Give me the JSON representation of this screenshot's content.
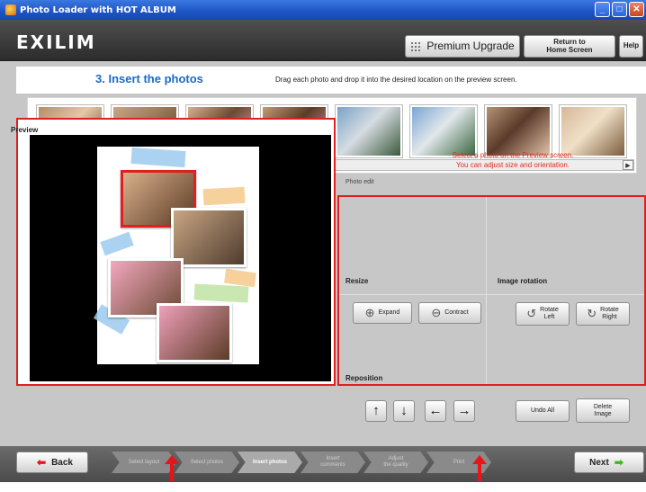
{
  "window": {
    "title": "Photo Loader with HOT ALBUM",
    "controls": [
      "_",
      "□",
      "✕"
    ]
  },
  "header": {
    "logo": "EXILIM",
    "premium_label": "Premium Upgrade",
    "home_label": "Return to\nHome Screen",
    "help_label": "Help"
  },
  "step": {
    "title": "3. Insert the photos",
    "instructions": "Drag each photo and drop it into the desired location on the preview screen."
  },
  "thumbnails": [
    {
      "name": "photo-thumb-1",
      "colors": [
        "#b58c64",
        "#5c3a24",
        "#e7c7a8"
      ]
    },
    {
      "name": "photo-thumb-2",
      "colors": [
        "#c8a684",
        "#4f3b2d",
        "#9c7a5a"
      ]
    },
    {
      "name": "photo-thumb-3",
      "colors": [
        "#d8b08c",
        "#f4a8c0",
        "#6b4a33"
      ]
    },
    {
      "name": "photo-thumb-4",
      "colors": [
        "#c49a72",
        "#f0a0bb",
        "#5b3c26"
      ]
    },
    {
      "name": "photo-thumb-5",
      "colors": [
        "#7aa3c9",
        "#3c5a3c",
        "#d6dce2"
      ]
    },
    {
      "name": "photo-thumb-6",
      "colors": [
        "#79a6d6",
        "#3a6640",
        "#e2e7ea"
      ]
    },
    {
      "name": "photo-thumb-7",
      "colors": [
        "#b59474",
        "#e2c2a6",
        "#5a3a2a"
      ]
    },
    {
      "name": "photo-thumb-8",
      "colors": [
        "#d6b898",
        "#7b5b3b",
        "#f0e0c8"
      ]
    }
  ],
  "scroll": {
    "left": "◀",
    "right": "▶"
  },
  "preview": {
    "label": "Preview"
  },
  "edit": {
    "hint": "Select a photo on the Preview screen.\nYou can adjust size and orientation.",
    "photo_edit_label": "Photo edit",
    "resize_label": "Resize",
    "expand_label": "Expand",
    "contract_label": "Contract",
    "rotation_label": "Image rotation",
    "rotate_left_label": "Rotate\nLeft",
    "rotate_right_label": "Rotate\nRight",
    "reposition_label": "Reposition",
    "up": "↑",
    "down": "↓",
    "left": "←",
    "right": "→",
    "undo_label": "Undo All",
    "delete_label": "Delete\nImage"
  },
  "footer": {
    "back_label": "Back",
    "next_label": "Next",
    "steps": [
      "Select layout",
      "Select photos",
      "Insert photos",
      "Insert\ncomments",
      "Adjust\nthe quality",
      "Print"
    ]
  }
}
